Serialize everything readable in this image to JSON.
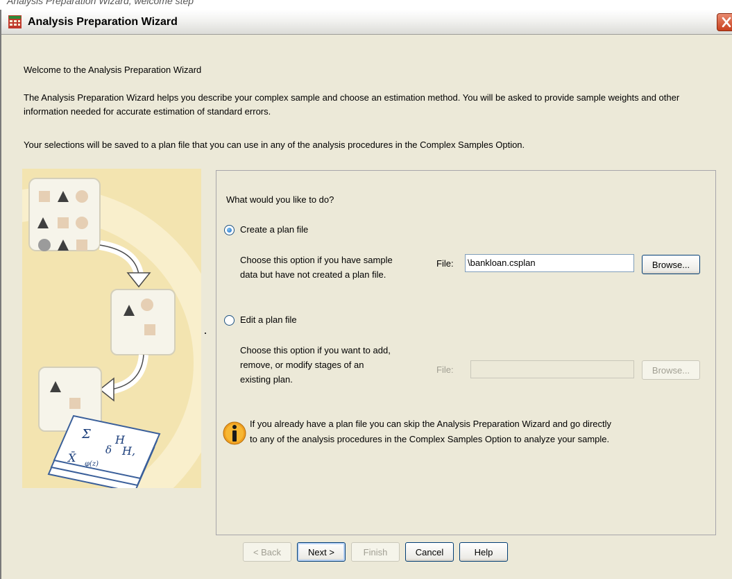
{
  "window": {
    "caption": "Analysis Preparation Wizard, welcome step",
    "title": "Analysis Preparation Wizard"
  },
  "intro": {
    "welcome": "Welcome to the Analysis Preparation Wizard",
    "description": "The Analysis Preparation Wizard helps you describe your complex sample and choose an estimation method. You will be asked to provide sample weights and other information needed for accurate estimation of standard errors.",
    "plan_note": "Your selections will be saved to a plan file that you can use in any of the analysis procedures in the Complex Samples Option."
  },
  "panel": {
    "question": "What would you like to do?",
    "options": [
      {
        "label": "Create a plan file",
        "selected": true,
        "help_lines": [
          "Choose this option if you have sample",
          "data but have not created a plan file."
        ],
        "file_label": "File:",
        "file_value": "\\bankloan.csplan",
        "browse_label": "Browse...",
        "enabled": true
      },
      {
        "label": "Edit a plan file",
        "selected": false,
        "help_lines": [
          "Choose this option if you want to add,",
          "remove, or modify stages of an",
          "existing plan."
        ],
        "file_label": "File:",
        "file_value": "",
        "browse_label": "Browse...",
        "enabled": false
      }
    ],
    "info_lines": [
      "If you already have a plan file you can skip the Analysis Preparation Wizard and go directly",
      "to any of the analysis procedures in the Complex Samples Option to analyze your sample."
    ]
  },
  "buttons": {
    "back": "< Back",
    "next": "Next >",
    "finish": "Finish",
    "cancel": "Cancel",
    "help": "Help"
  },
  "icons": {
    "title": "spreadsheet-grid-icon",
    "close": "close-icon",
    "info": "info-icon"
  },
  "colors": {
    "dialog_bg": "#ece9d8",
    "illustration_bg": "#f3e4b0",
    "close_button": "#d9542e",
    "info_icon": "#f0a020"
  }
}
